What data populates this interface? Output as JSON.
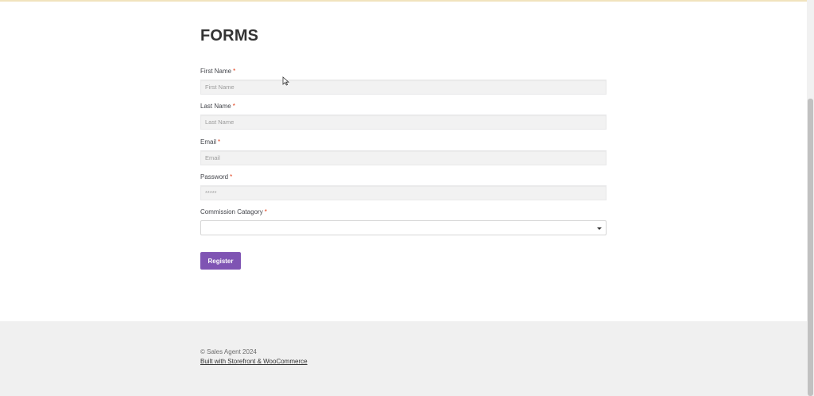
{
  "page": {
    "title": "FORMS"
  },
  "form": {
    "fields": [
      {
        "label": "First Name",
        "required_mark": "*",
        "placeholder": "First Name",
        "value": ""
      },
      {
        "label": "Last Name",
        "required_mark": "*",
        "placeholder": "Last Name",
        "value": ""
      },
      {
        "label": "Email",
        "required_mark": "*",
        "placeholder": "Email",
        "value": ""
      },
      {
        "label": "Password",
        "required_mark": "*",
        "placeholder": "*****",
        "value": ""
      }
    ],
    "select": {
      "label": "Commission Catagory",
      "required_mark": "*",
      "selected": ""
    },
    "submit_label": "Register"
  },
  "footer": {
    "copyright": "© Sales Agent 2024",
    "credit_link": "Built with Storefront & WooCommerce"
  },
  "colors": {
    "accent": "#7f54b3",
    "required": "#e2401c"
  }
}
